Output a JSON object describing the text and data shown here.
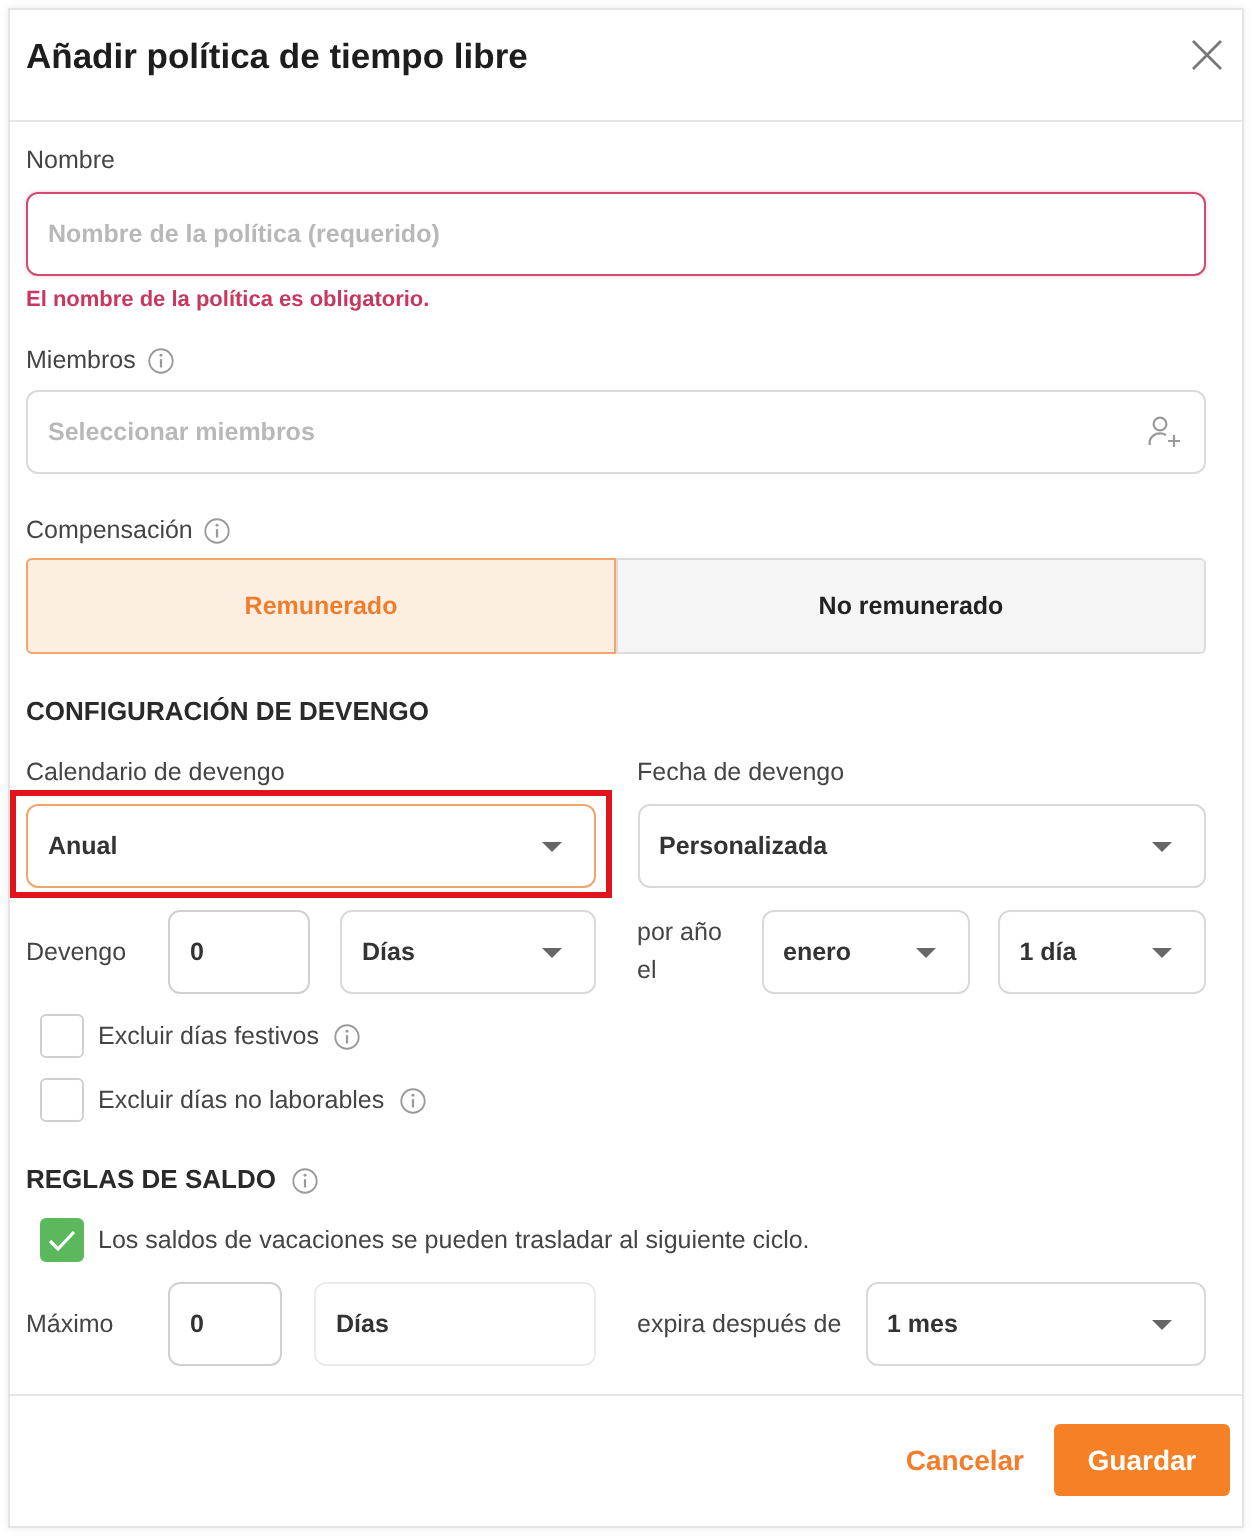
{
  "dialog": {
    "title": "Añadir política de tiempo libre"
  },
  "name_field": {
    "label": "Nombre",
    "placeholder": "Nombre de la política (requerido)",
    "error": "El nombre de la política es obligatorio."
  },
  "members_field": {
    "label": "Miembros",
    "placeholder": "Seleccionar miembros"
  },
  "compensation": {
    "label": "Compensación",
    "options": [
      {
        "label": "Remunerado",
        "selected": true
      },
      {
        "label": "No remunerado",
        "selected": false
      }
    ]
  },
  "accrual": {
    "heading": "CONFIGURACIÓN DE DEVENGO",
    "schedule": {
      "label": "Calendario de devengo",
      "value": "Anual",
      "focused": true,
      "highlighted": true
    },
    "date": {
      "label": "Fecha de devengo",
      "value": "Personalizada"
    },
    "amount": {
      "label": "Devengo",
      "value": "0",
      "unit": "Días",
      "period_label": "por año el",
      "month": "enero",
      "day": "1 día"
    },
    "options": [
      {
        "label": "Excluir días festivos",
        "checked": false
      },
      {
        "label": "Excluir días no laborables",
        "checked": false
      }
    ]
  },
  "balance_rules": {
    "heading": "REGLAS DE SALDO",
    "carryover": {
      "label": "Los saldos de vacaciones se pueden trasladar al siguiente ciclo.",
      "checked": true
    },
    "maximum": {
      "label": "Máximo",
      "value": "0",
      "unit": "Días"
    },
    "expiry": {
      "label": "expira después de",
      "value": "1 mes"
    }
  },
  "footer": {
    "buttons": [
      {
        "label": "Cancelar",
        "kind": "text"
      },
      {
        "label": "Guardar",
        "kind": "primary"
      }
    ]
  }
}
